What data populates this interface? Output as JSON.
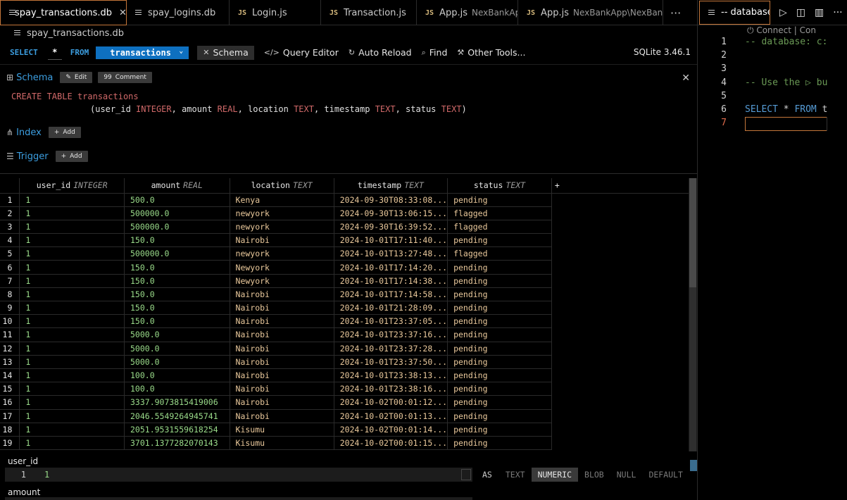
{
  "tabs": [
    {
      "label": "spay_transactions.db",
      "type": "db",
      "active": true,
      "sub": ""
    },
    {
      "label": "spay_logins.db",
      "type": "db",
      "active": false,
      "sub": ""
    },
    {
      "label": "Login.js",
      "type": "js",
      "active": false,
      "sub": ""
    },
    {
      "label": "Transaction.js",
      "type": "js",
      "active": false,
      "sub": ""
    },
    {
      "label": "App.js",
      "type": "js",
      "active": false,
      "sub": "NexBankApp"
    },
    {
      "label": "App.js",
      "type": "js",
      "active": false,
      "sub": "NexBankApp\\NexBankAp"
    }
  ],
  "js_badge": "JS",
  "more_label": "···",
  "close_glyph": "✕",
  "breadcrumb": "spay_transactions.db",
  "query": {
    "select_kw": "SELECT",
    "star": "*",
    "from_kw": "FROM",
    "table": "transactions",
    "schema_btn": "Schema",
    "query_editor_btn": "Query Editor",
    "auto_reload_btn": "Auto Reload",
    "find_btn": "Find",
    "other_tools_btn": "Other Tools...",
    "version": "SQLite 3.46.1"
  },
  "schema": {
    "title": "Schema",
    "edit": "Edit",
    "comment": "Comment",
    "ddl_line1_kw": "CREATE TABLE",
    "ddl_line1_name": "transactions",
    "ddl_cols": [
      {
        "name": "user_id",
        "type": "INTEGER"
      },
      {
        "name": "amount",
        "type": "REAL"
      },
      {
        "name": "location",
        "type": "TEXT"
      },
      {
        "name": "timestamp",
        "type": "TEXT"
      },
      {
        "name": "status",
        "type": "TEXT"
      }
    ],
    "index_title": "Index",
    "trigger_title": "Trigger",
    "add": "Add"
  },
  "grid": {
    "columns": [
      {
        "name": "user_id",
        "type": "INTEGER"
      },
      {
        "name": "amount",
        "type": "REAL"
      },
      {
        "name": "location",
        "type": "TEXT"
      },
      {
        "name": "timestamp",
        "type": "TEXT"
      },
      {
        "name": "status",
        "type": "TEXT"
      }
    ],
    "add_col": "+",
    "rows": [
      [
        "1",
        "1",
        "500.0",
        "Kenya",
        "2024-09-30T08:33:08...",
        "pending"
      ],
      [
        "2",
        "1",
        "500000.0",
        "newyork",
        "2024-09-30T13:06:15...",
        "flagged"
      ],
      [
        "3",
        "1",
        "500000.0",
        "newyork",
        "2024-09-30T16:39:52...",
        "flagged"
      ],
      [
        "4",
        "1",
        "150.0",
        "Nairobi",
        "2024-10-01T17:11:40...",
        "pending"
      ],
      [
        "5",
        "1",
        "500000.0",
        "newyork",
        "2024-10-01T13:27:48...",
        "flagged"
      ],
      [
        "6",
        "1",
        "150.0",
        "Newyork",
        "2024-10-01T17:14:20...",
        "pending"
      ],
      [
        "7",
        "1",
        "150.0",
        "Newyork",
        "2024-10-01T17:14:38...",
        "pending"
      ],
      [
        "8",
        "1",
        "150.0",
        "Nairobi",
        "2024-10-01T17:14:58...",
        "pending"
      ],
      [
        "9",
        "1",
        "150.0",
        "Nairobi",
        "2024-10-01T21:28:09...",
        "pending"
      ],
      [
        "10",
        "1",
        "150.0",
        "Nairobi",
        "2024-10-01T23:37:05...",
        "pending"
      ],
      [
        "11",
        "1",
        "5000.0",
        "Nairobi",
        "2024-10-01T23:37:16...",
        "pending"
      ],
      [
        "12",
        "1",
        "5000.0",
        "Nairobi",
        "2024-10-01T23:37:28...",
        "pending"
      ],
      [
        "13",
        "1",
        "5000.0",
        "Nairobi",
        "2024-10-01T23:37:50...",
        "pending"
      ],
      [
        "14",
        "1",
        "100.0",
        "Nairobi",
        "2024-10-01T23:38:13...",
        "pending"
      ],
      [
        "15",
        "1",
        "100.0",
        "Nairobi",
        "2024-10-01T23:38:16...",
        "pending"
      ],
      [
        "16",
        "1",
        "3337.9073815419006",
        "Nairobi",
        "2024-10-02T00:01:12...",
        "pending"
      ],
      [
        "17",
        "1",
        "2046.5549264945741",
        "Nairobi",
        "2024-10-02T00:01:13...",
        "pending"
      ],
      [
        "18",
        "1",
        "2051.9531559618254",
        "Kisumu",
        "2024-10-02T00:01:14...",
        "pending"
      ],
      [
        "19",
        "1",
        "3701.1377282070143",
        "Kisumu",
        "2024-10-02T00:01:15...",
        "pending"
      ]
    ]
  },
  "editor": {
    "field1": "user_id",
    "field1_line": "1",
    "field1_value": "1",
    "field2": "amount",
    "as_label": "AS",
    "types": [
      "TEXT",
      "NUMERIC",
      "BLOB",
      "NULL",
      "DEFAULT"
    ],
    "selected_type": "NUMERIC"
  },
  "right_panel": {
    "tab_label": "-- database:",
    "connect": "Connect | Con",
    "lines": [
      {
        "no": "1",
        "text": "-- database: c:",
        "kind": "comment"
      },
      {
        "no": "2",
        "text": "",
        "kind": "plain"
      },
      {
        "no": "3",
        "text": "",
        "kind": "plain"
      },
      {
        "no": "4",
        "text": "-- Use the ▷ bu",
        "kind": "comment"
      },
      {
        "no": "5",
        "text": "",
        "kind": "plain"
      },
      {
        "no": "6",
        "text": "SELECT * FROM t",
        "kind": "sql"
      },
      {
        "no": "7",
        "text": "",
        "kind": "current"
      }
    ]
  },
  "colors": {
    "accent": "#0e70c0",
    "keyword": "#3c9ee0",
    "number": "#9adb8a",
    "text": "#e9c89b",
    "active_border": "#c4763a"
  }
}
